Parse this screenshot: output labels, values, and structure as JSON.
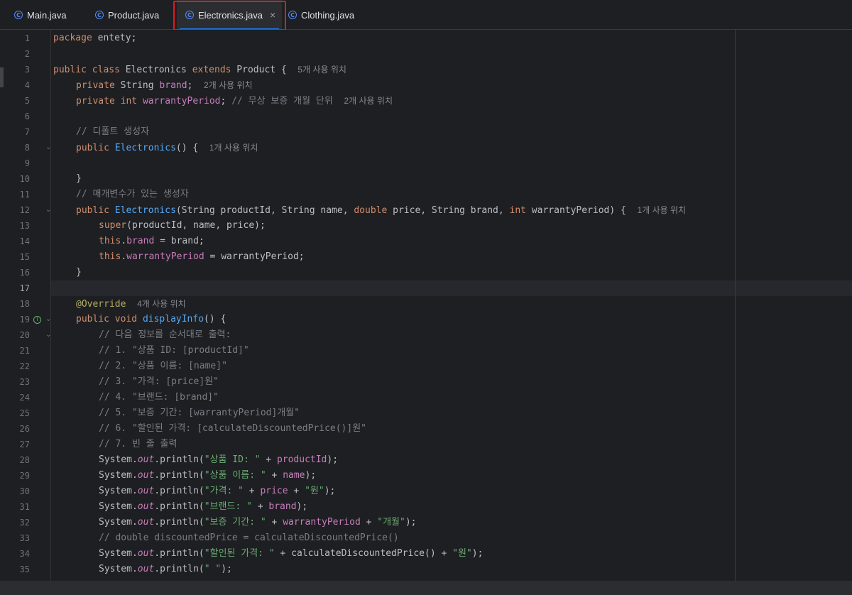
{
  "tabs": [
    {
      "label": "Main.java",
      "active": false
    },
    {
      "label": "Product.java",
      "active": false
    },
    {
      "label": "Electronics.java",
      "active": true,
      "close": "×"
    },
    {
      "label": "Clothing.java",
      "active": false
    }
  ],
  "tab_icon_letter": "C",
  "impl_icon_letter": "I",
  "code": {
    "l1": {
      "num": "1",
      "kw1": "package",
      "t1": " entety;"
    },
    "l2": {
      "num": "2"
    },
    "l3": {
      "num": "3",
      "kw1": "public",
      "kw2": "class",
      "t1": " Electronics ",
      "kw3": "extends",
      "t2": " Product {",
      "hint": "5개 사용 위치"
    },
    "l4": {
      "num": "4",
      "kw1": "private",
      "t1": " String ",
      "f1": "brand",
      "t2": ";",
      "hint": "2개 사용 위치"
    },
    "l5": {
      "num": "5",
      "kw1": "private",
      "kw2": "int",
      "t1": " ",
      "f1": "warrantyPeriod",
      "t2": "; ",
      "c1": "// 무상 보증 개월 단위",
      "hint": "2개 사용 위치"
    },
    "l6": {
      "num": "6"
    },
    "l7": {
      "num": "7",
      "c1": "// 디폴트 생성자"
    },
    "l8": {
      "num": "8",
      "kw1": "public",
      "fn1": "Electronics",
      "t1": "() {",
      "hint": "1개 사용 위치"
    },
    "l9": {
      "num": "9"
    },
    "l10": {
      "num": "10",
      "t1": "}"
    },
    "l11": {
      "num": "11",
      "c1": "// 매개변수가 있는 생성자"
    },
    "l12": {
      "num": "12",
      "kw1": "public",
      "fn1": "Electronics",
      "t1": "(String productId, String name, ",
      "kw2": "double",
      "t2": " price, String brand, ",
      "kw3": "int",
      "t3": " warrantyPeriod) {",
      "hint": "1개 사용 위치"
    },
    "l13": {
      "num": "13",
      "kw1": "super",
      "t1": "(productId, name, price);"
    },
    "l14": {
      "num": "14",
      "kw1": "this",
      "t1": ".",
      "f1": "brand",
      "t2": " = brand;"
    },
    "l15": {
      "num": "15",
      "kw1": "this",
      "t1": ".",
      "f1": "warrantyPeriod",
      "t2": " = warrantyPeriod;"
    },
    "l16": {
      "num": "16",
      "t1": "}"
    },
    "l17": {
      "num": "17"
    },
    "l18": {
      "num": "18",
      "a1": "@Override",
      "hint": "4개 사용 위치"
    },
    "l19": {
      "num": "19",
      "kw1": "public",
      "kw2": "void",
      "fn1": "displayInfo",
      "t1": "() {"
    },
    "l20": {
      "num": "20",
      "c1": "// 다음 정보를 순서대로 출력:"
    },
    "l21": {
      "num": "21",
      "c1": "// 1. \"상품 ID: [productId]\""
    },
    "l22": {
      "num": "22",
      "c1": "// 2. \"상품 이름: [name]\""
    },
    "l23": {
      "num": "23",
      "c1": "// 3. \"가격: [price]원\""
    },
    "l24": {
      "num": "24",
      "c1": "// 4. \"브랜드: [brand]\""
    },
    "l25": {
      "num": "25",
      "c1": "// 5. \"보증 기간: [warrantyPeriod]개월\""
    },
    "l26": {
      "num": "26",
      "c1": "// 6. \"할인된 가격: [calculateDiscountedPrice()]원\""
    },
    "l27": {
      "num": "27",
      "c1": "// 7. 빈 줄 출력"
    },
    "l28": {
      "num": "28",
      "t1": "System.",
      "s1": "out",
      "t2": ".println(",
      "str1": "\"상품 ID: \"",
      "t3": " + ",
      "f1": "productId",
      "t4": ");"
    },
    "l29": {
      "num": "29",
      "t1": "System.",
      "s1": "out",
      "t2": ".println(",
      "str1": "\"상품 이름: \"",
      "t3": " + ",
      "f1": "name",
      "t4": ");"
    },
    "l30": {
      "num": "30",
      "t1": "System.",
      "s1": "out",
      "t2": ".println(",
      "str1": "\"가격: \"",
      "t3": " + ",
      "f1": "price",
      "t4": " + ",
      "str2": "\"원\"",
      "t5": ");"
    },
    "l31": {
      "num": "31",
      "t1": "System.",
      "s1": "out",
      "t2": ".println(",
      "str1": "\"브랜드: \"",
      "t3": " + ",
      "f1": "brand",
      "t4": ");"
    },
    "l32": {
      "num": "32",
      "t1": "System.",
      "s1": "out",
      "t2": ".println(",
      "str1": "\"보증 기간: \"",
      "t3": " + ",
      "f1": "warrantyPeriod",
      "t4": " + ",
      "str2": "\"개월\"",
      "t5": ");"
    },
    "l33": {
      "num": "33",
      "c1": "// double discountedPrice = calculateDiscountedPrice()"
    },
    "l34": {
      "num": "34",
      "t1": "System.",
      "s1": "out",
      "t2": ".println(",
      "str1": "\"할인된 가격: \"",
      "t3": " + calculateDiscountedPrice() + ",
      "str2": "\"원\"",
      "t4": ");"
    },
    "l35": {
      "num": "35",
      "t1": "System.",
      "s1": "out",
      "t2": ".println(",
      "str1": "\" \"",
      "t3": ");"
    }
  }
}
